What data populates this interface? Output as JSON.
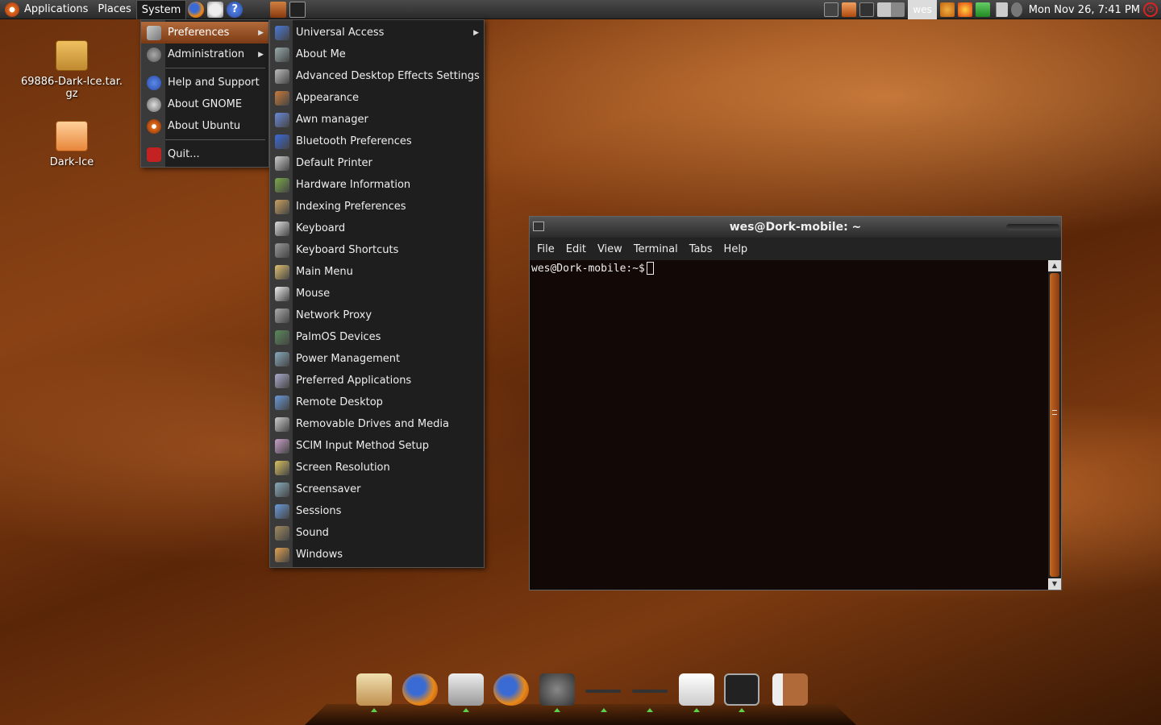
{
  "top_panel": {
    "menus": [
      "Applications",
      "Places",
      "System"
    ],
    "user": "wes",
    "clock": "Mon Nov 26,  7:41 PM"
  },
  "desktop": {
    "icons": [
      {
        "label_line1": "69886-Dark-Ice.tar.",
        "label_line2": "gz"
      },
      {
        "label_line1": "Dark-Ice",
        "label_line2": ""
      }
    ]
  },
  "system_menu": {
    "items": [
      "Preferences",
      "Administration",
      "Help and Support",
      "About GNOME",
      "About Ubuntu",
      "Quit..."
    ]
  },
  "preferences_menu": {
    "items": [
      "Universal Access",
      "About Me",
      "Advanced Desktop Effects Settings",
      "Appearance",
      "Awn manager",
      "Bluetooth Preferences",
      "Default Printer",
      "Hardware Information",
      "Indexing Preferences",
      "Keyboard",
      "Keyboard Shortcuts",
      "Main Menu",
      "Mouse",
      "Network Proxy",
      "PalmOS Devices",
      "Power Management",
      "Preferred Applications",
      "Remote Desktop",
      "Removable Drives and Media",
      "SCIM Input Method Setup",
      "Screen Resolution",
      "Screensaver",
      "Sessions",
      "Sound",
      "Windows"
    ]
  },
  "terminal": {
    "title": "wes@Dork-mobile: ~",
    "menus": [
      "File",
      "Edit",
      "View",
      "Terminal",
      "Tabs",
      "Help"
    ],
    "prompt": "wes@Dork-mobile:~$"
  },
  "colors": {
    "accent": "#b26a3a",
    "scrollbar": "#c06a24",
    "dock_indicator": "#5dd34a"
  }
}
